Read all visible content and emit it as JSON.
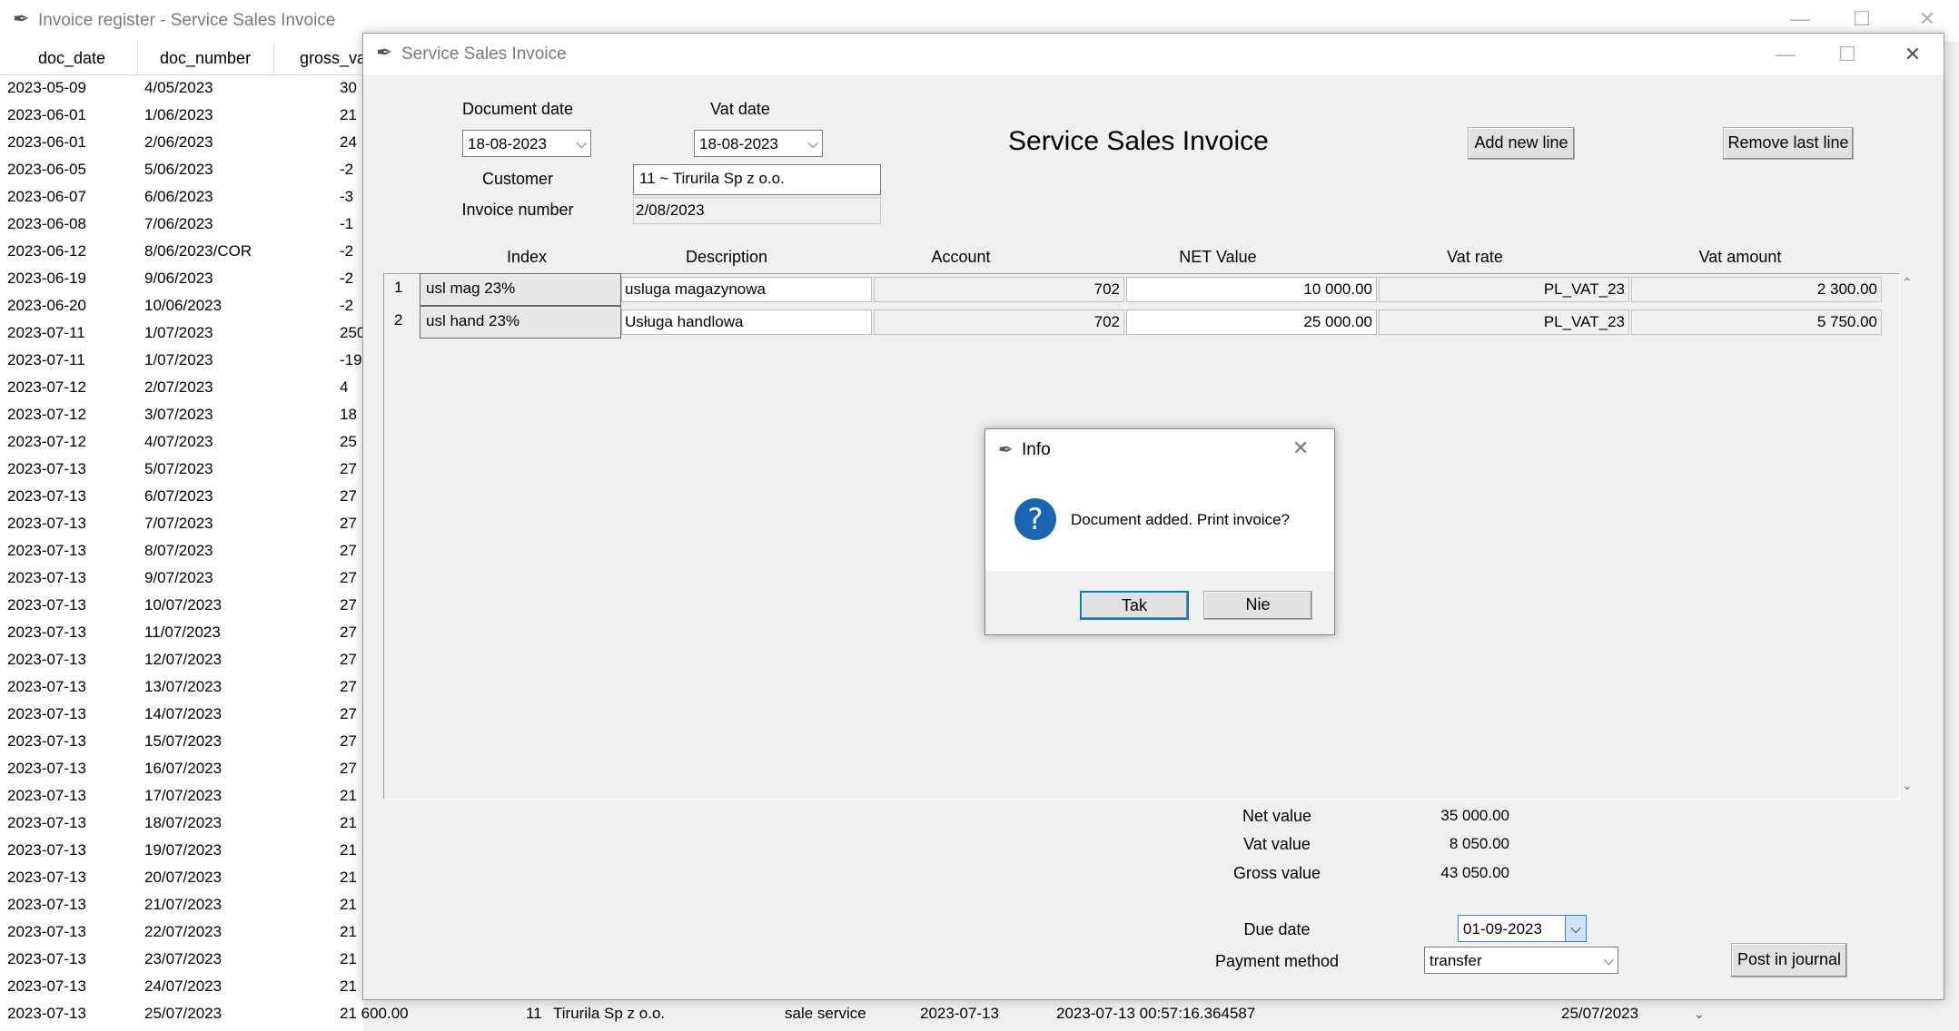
{
  "bg_window": {
    "title": "Invoice register - Service Sales Invoice",
    "columns": [
      "doc_date",
      "doc_number",
      "gross_va"
    ],
    "rows": [
      {
        "date": "2023-05-09",
        "number": "4/05/2023",
        "gross": "30"
      },
      {
        "date": "2023-06-01",
        "number": "1/06/2023",
        "gross": "21"
      },
      {
        "date": "2023-06-01",
        "number": "2/06/2023",
        "gross": "24"
      },
      {
        "date": "2023-06-05",
        "number": "5/06/2023",
        "gross": "-2"
      },
      {
        "date": "2023-06-07",
        "number": "6/06/2023",
        "gross": "-3"
      },
      {
        "date": "2023-06-08",
        "number": "7/06/2023",
        "gross": "-1"
      },
      {
        "date": "2023-06-12",
        "number": "8/06/2023/COR",
        "gross": "-2"
      },
      {
        "date": "2023-06-19",
        "number": "9/06/2023",
        "gross": "-2"
      },
      {
        "date": "2023-06-20",
        "number": "10/06/2023",
        "gross": "-2"
      },
      {
        "date": "2023-07-11",
        "number": "1/07/2023",
        "gross": "250"
      },
      {
        "date": "2023-07-11",
        "number": "1/07/2023",
        "gross": "-19"
      },
      {
        "date": "2023-07-12",
        "number": "2/07/2023",
        "gross": "4"
      },
      {
        "date": "2023-07-12",
        "number": "3/07/2023",
        "gross": "18"
      },
      {
        "date": "2023-07-12",
        "number": "4/07/2023",
        "gross": "25"
      },
      {
        "date": "2023-07-13",
        "number": "5/07/2023",
        "gross": "27"
      },
      {
        "date": "2023-07-13",
        "number": "6/07/2023",
        "gross": "27"
      },
      {
        "date": "2023-07-13",
        "number": "7/07/2023",
        "gross": "27"
      },
      {
        "date": "2023-07-13",
        "number": "8/07/2023",
        "gross": "27"
      },
      {
        "date": "2023-07-13",
        "number": "9/07/2023",
        "gross": "27"
      },
      {
        "date": "2023-07-13",
        "number": "10/07/2023",
        "gross": "27"
      },
      {
        "date": "2023-07-13",
        "number": "11/07/2023",
        "gross": "27"
      },
      {
        "date": "2023-07-13",
        "number": "12/07/2023",
        "gross": "27"
      },
      {
        "date": "2023-07-13",
        "number": "13/07/2023",
        "gross": "27"
      },
      {
        "date": "2023-07-13",
        "number": "14/07/2023",
        "gross": "27"
      },
      {
        "date": "2023-07-13",
        "number": "15/07/2023",
        "gross": "27"
      },
      {
        "date": "2023-07-13",
        "number": "16/07/2023",
        "gross": "27"
      },
      {
        "date": "2023-07-13",
        "number": "17/07/2023",
        "gross": "21"
      },
      {
        "date": "2023-07-13",
        "number": "18/07/2023",
        "gross": "21"
      },
      {
        "date": "2023-07-13",
        "number": "19/07/2023",
        "gross": "21"
      },
      {
        "date": "2023-07-13",
        "number": "20/07/2023",
        "gross": "21"
      },
      {
        "date": "2023-07-13",
        "number": "21/07/2023",
        "gross": "21"
      },
      {
        "date": "2023-07-13",
        "number": "22/07/2023",
        "gross": "21"
      },
      {
        "date": "2023-07-13",
        "number": "23/07/2023",
        "gross": "21"
      },
      {
        "date": "2023-07-13",
        "number": "24/07/2023",
        "gross": "21"
      }
    ],
    "last_row": {
      "date": "2023-07-13",
      "number": "25/07/2023",
      "gross": "21 600.00",
      "cust_id": "11",
      "customer": "Tirurila Sp z o.o.",
      "type": "sale service",
      "vat_date": "2023-07-13",
      "timestamp": "2023-07-13 00:57:16.364587",
      "ref": "25/07/2023"
    }
  },
  "invoice_window": {
    "title": "Service Sales Invoice",
    "heading": "Service Sales Invoice",
    "document_date_label": "Document date",
    "document_date": "18-08-2023",
    "vat_date_label": "Vat date",
    "vat_date": "18-08-2023",
    "customer_label": "Customer",
    "customer": "11 ~ Tirurila Sp z o.o.",
    "invoice_number_label": "Invoice number",
    "invoice_number": "2/08/2023",
    "add_line_label": "Add new line",
    "remove_line_label": "Remove last line",
    "columns": [
      "Index",
      "Description",
      "Account",
      "NET Value",
      "Vat rate",
      "Vat amount"
    ],
    "lines": [
      {
        "no": "1",
        "index": "usl mag 23%",
        "description": "usluga magazynowa",
        "account": "702",
        "net": "10 000.00",
        "vat_rate": "PL_VAT_23",
        "vat_amount": "2 300.00"
      },
      {
        "no": "2",
        "index": "usl hand 23%",
        "description": "Usługa handlowa",
        "account": "702",
        "net": "25 000.00",
        "vat_rate": "PL_VAT_23",
        "vat_amount": "5 750.00"
      }
    ],
    "net_value_label": "Net value",
    "net_value": "35 000.00",
    "vat_value_label": "Vat value",
    "vat_value": "8 050.00",
    "gross_value_label": "Gross value",
    "gross_value": "43 050.00",
    "due_date_label": "Due date",
    "due_date": "01-09-2023",
    "payment_method_label": "Payment method",
    "payment_method": "transfer",
    "post_label": "Post in journal"
  },
  "dialog": {
    "title": "Info",
    "message": "Document added. Print invoice?",
    "yes_label": "Tak",
    "no_label": "Nie",
    "icon": "question-icon",
    "icon_color": "#1a64b4"
  }
}
